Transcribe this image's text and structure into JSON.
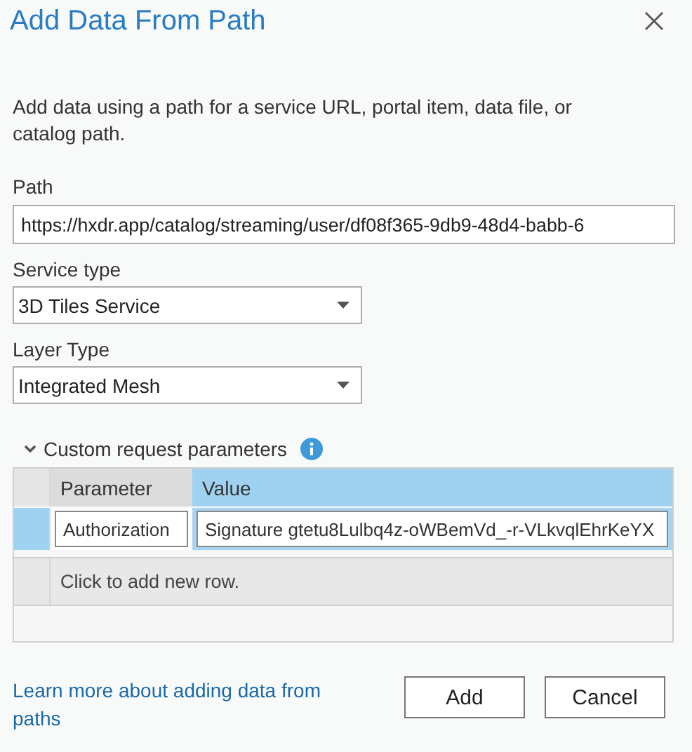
{
  "window": {
    "title": "Add Data From Path"
  },
  "description": "Add data using a path for a service URL, portal item, data file, or catalog path.",
  "path": {
    "label": "Path",
    "value": "https://hxdr.app/catalog/streaming/user/df08f365-9db9-48d4-babb-6"
  },
  "service_type": {
    "label": "Service type",
    "value": "3D Tiles Service"
  },
  "layer_type": {
    "label": "Layer Type",
    "value": "Integrated Mesh"
  },
  "custom_parameters": {
    "label": "Custom request parameters",
    "expanded": true,
    "columns": [
      {
        "label": "Parameter",
        "selected": false
      },
      {
        "label": "Value",
        "selected": true
      }
    ],
    "rows": [
      {
        "selected": true,
        "cells": [
          "Authorization",
          "Signature gtetu8Lulbq4z-oWBemVd_-r-VLkvqlEhrKeYX"
        ]
      }
    ],
    "new_row": "Click to add new row."
  },
  "help_link": "Learn more about adding data from paths",
  "buttons": [
    "Add",
    "Cancel"
  ]
}
